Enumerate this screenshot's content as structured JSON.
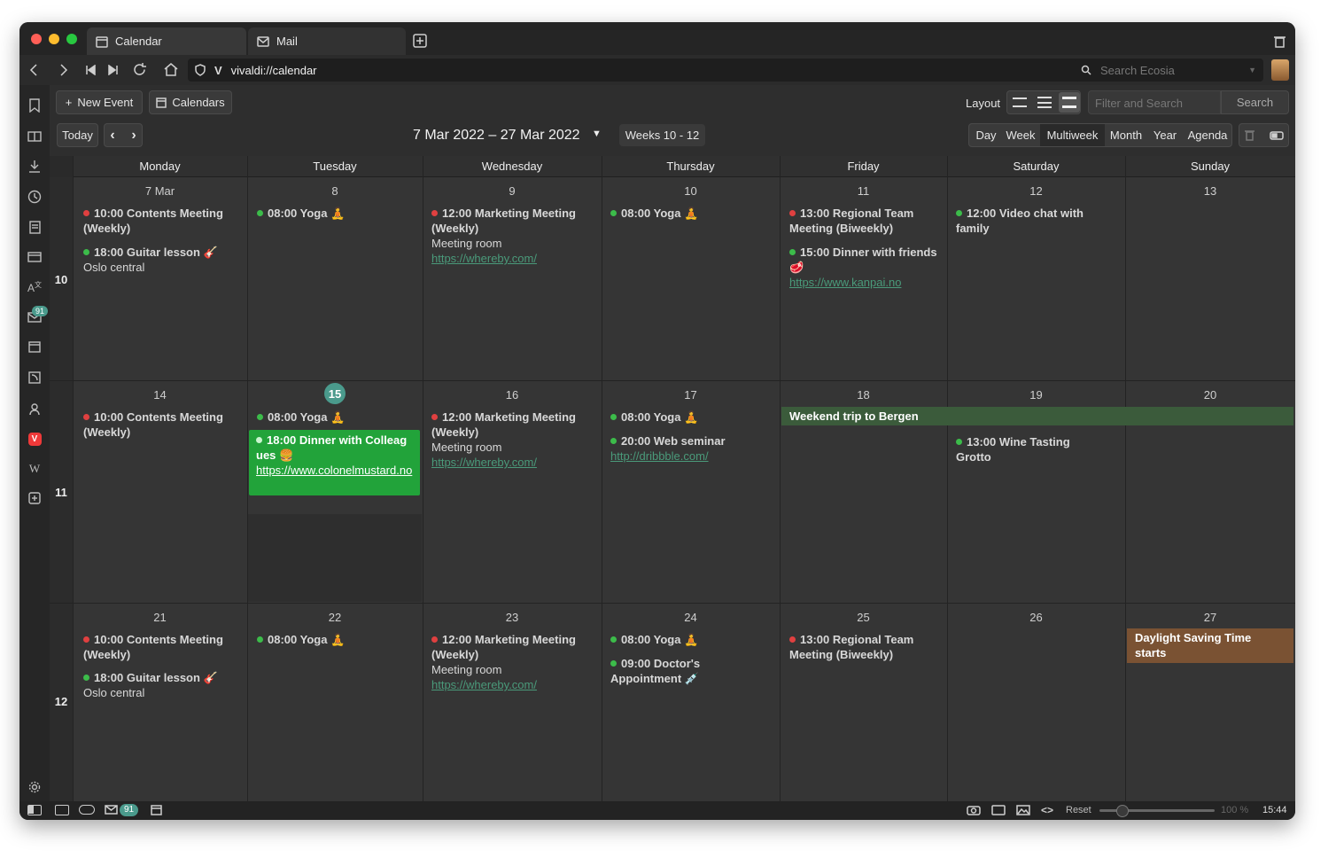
{
  "tabs": [
    {
      "label": "Calendar",
      "icon": "calendar-icon"
    },
    {
      "label": "Mail",
      "icon": "mail-icon"
    }
  ],
  "address": "vivaldi://calendar",
  "search_placeholder": "Search Ecosia",
  "toolbar": {
    "new_event": "New Event",
    "calendars": "Calendars",
    "layout": "Layout",
    "filter_placeholder": "Filter and Search",
    "search": "Search",
    "today": "Today",
    "range": "7 Mar 2022 – 27 Mar 2022",
    "weeks": "Weeks 10 - 12"
  },
  "views": [
    "Day",
    "Week",
    "Multiweek",
    "Month",
    "Year",
    "Agenda"
  ],
  "days": [
    "Monday",
    "Tuesday",
    "Wednesday",
    "Thursday",
    "Friday",
    "Saturday",
    "Sunday"
  ],
  "weeks": [
    {
      "num": "10",
      "dates": [
        "7 Mar",
        "8",
        "9",
        "10",
        "11",
        "12",
        "13"
      ]
    },
    {
      "num": "11",
      "dates": [
        "14",
        "15",
        "16",
        "17",
        "18",
        "19",
        "20"
      ]
    },
    {
      "num": "12",
      "dates": [
        "21",
        "22",
        "23",
        "24",
        "25",
        "26",
        "27"
      ]
    }
  ],
  "events": {
    "w10mon1": "10:00 Contents Meeting (Weekly)",
    "w10mon2": "18:00 Guitar lesson 🎸",
    "w10mon2loc": "Oslo central",
    "w10tue": "08:00 Yoga 🧘",
    "w10wed": "12:00 Marketing Meeting (Weekly)",
    "w10wedloc": "Meeting room",
    "w10wedurl": "https://whereby.com/",
    "w10thu": "08:00 Yoga 🧘",
    "w10fri1": "13:00 Regional Team Meeting (Biweekly)",
    "w10fri2": "15:00 Dinner with friends 🥩",
    "w10fri2url": "https://www.kanpai.no",
    "w10sat": "12:00 Video chat with family",
    "w11mon": "10:00 Contents Meeting (Weekly)",
    "w11tue1": "08:00 Yoga 🧘",
    "w11tue2": "18:00 Dinner with Colleagues 🍔",
    "w11tue2url": "https://www.colonelmustard.no",
    "w11wed": "12:00 Marketing Meeting (Weekly)",
    "w11wedloc": "Meeting room",
    "w11wedurl": "https://whereby.com/",
    "w11thu1": "08:00 Yoga 🧘",
    "w11thu2": "20:00 Web seminar",
    "w11thu2url": "http://dribbble.com/",
    "w11trip": "Weekend trip to Bergen",
    "w11sat": "13:00 Wine Tasting",
    "w11satloc": "Grotto",
    "w12mon1": "10:00 Contents Meeting (Weekly)",
    "w12mon2": "18:00 Guitar lesson 🎸",
    "w12mon2loc": "Oslo central",
    "w12tue": "08:00 Yoga 🧘",
    "w12wed": "12:00 Marketing Meeting (Weekly)",
    "w12wedloc": "Meeting room",
    "w12wedurl": "https://whereby.com/",
    "w12thu1": "08:00 Yoga 🧘",
    "w12thu2": "09:00 Doctor's Appointment 💉",
    "w12fri": "13:00 Regional Team Meeting (Biweekly)",
    "w12sun": "Daylight Saving Time starts"
  },
  "mail_badge": "91",
  "status": {
    "reset": "Reset",
    "zoom": "100 %",
    "time": "15:44"
  },
  "colors": {
    "today_badge": "#4a9a8c",
    "green_event": "#22a33a",
    "trip": "#3b5b3b",
    "dst": "#7a5233"
  }
}
